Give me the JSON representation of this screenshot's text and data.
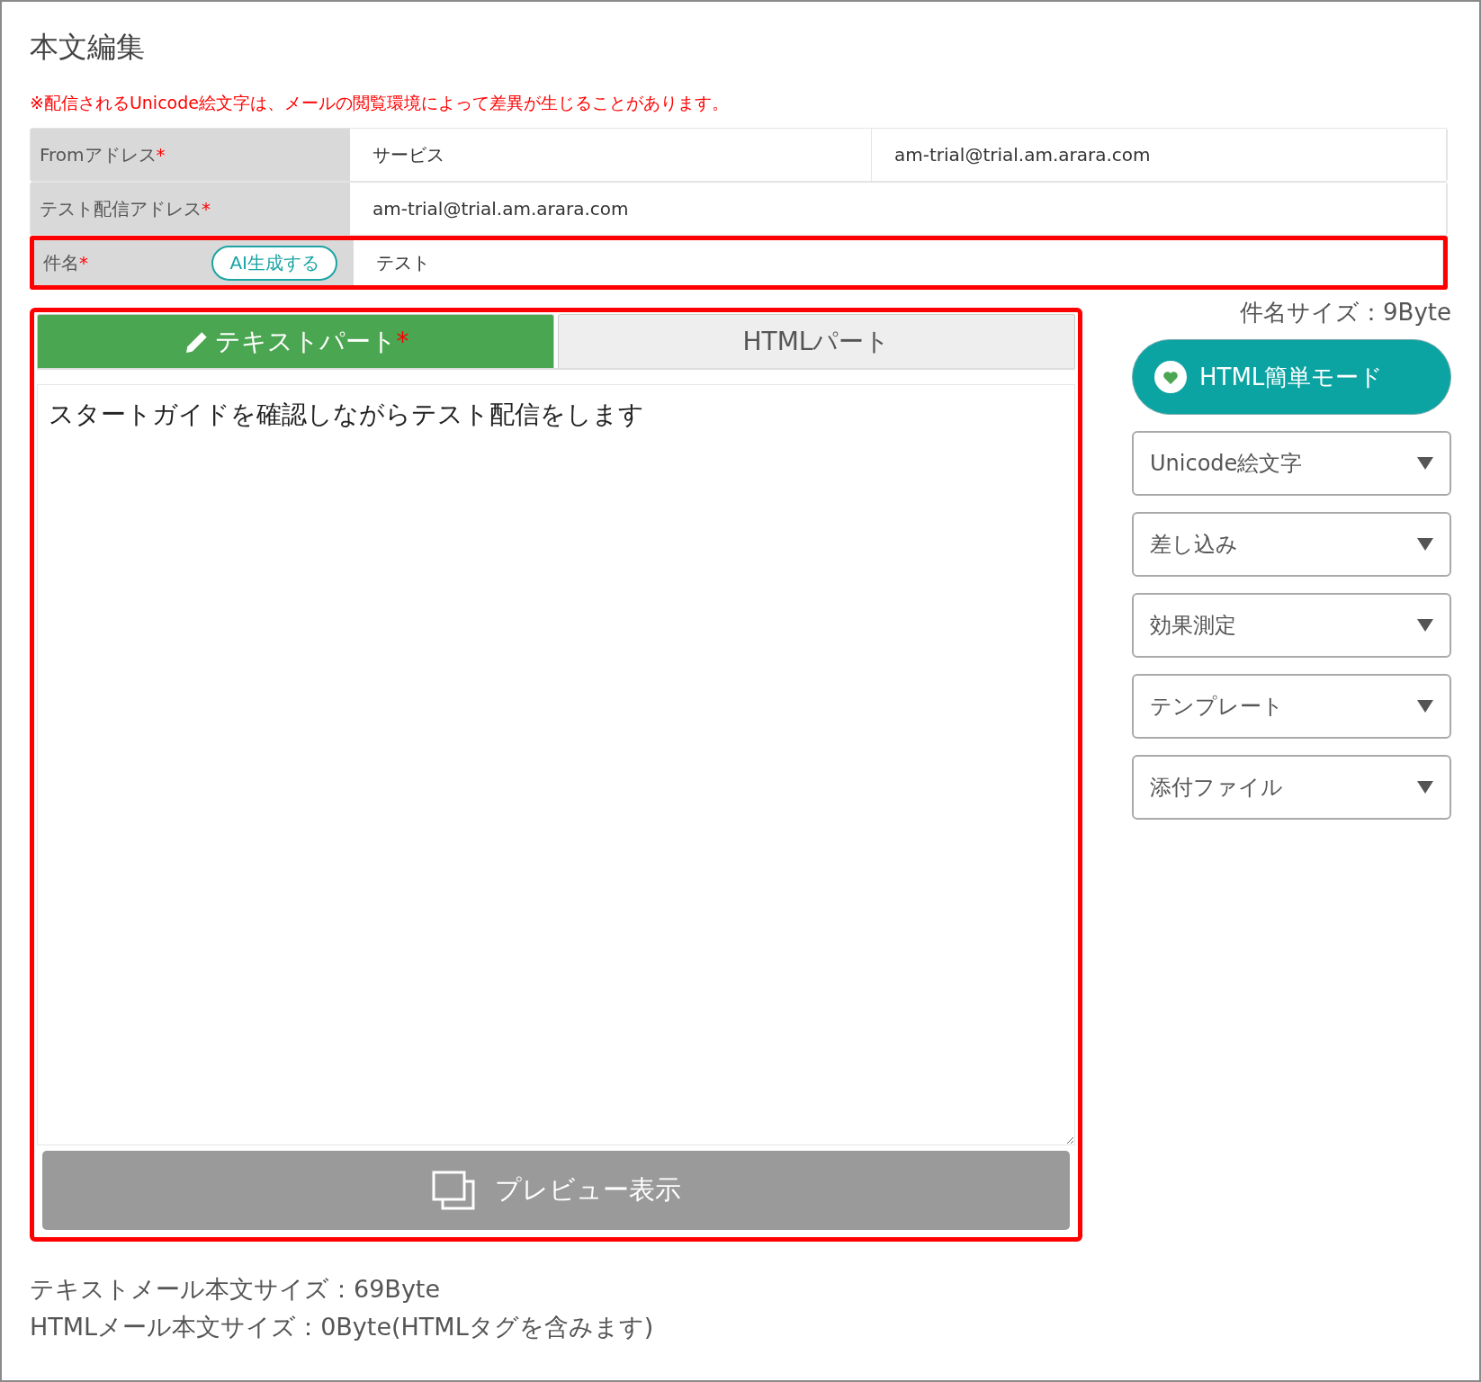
{
  "title": "本文編集",
  "notice": "※配信されるUnicode絵文字は、メールの閲覧環境によって差異が生じることがあります。",
  "fields": [
    {
      "label": "Fromアドレス",
      "mark": "*",
      "values": [
        "サービス",
        "am-trial@trial.am.arara.com"
      ],
      "highlighted": false
    },
    {
      "label": "テスト配信アドレス",
      "mark": "*",
      "values": [
        "am-trial@trial.am.arara.com"
      ],
      "highlighted": false
    },
    {
      "label": "件名",
      "mark": "*",
      "button": "AI生成する",
      "values": [
        "テスト"
      ],
      "highlighted": true
    }
  ],
  "editor": {
    "highlighted": true,
    "tabs": [
      {
        "label": "テキストパート",
        "mark": "*",
        "selected": true
      },
      {
        "label": "HTMLパート",
        "selected": false
      }
    ],
    "value": "スタートガイドを確認しながらテスト配信をします",
    "preview_button": "プレビュー表示"
  },
  "subject_size": "件名サイズ：9Byte",
  "mode_button": "HTML簡単モード",
  "dropdowns": [
    "Unicode絵文字",
    "差し込み",
    "効果測定",
    "テンプレート",
    "添付ファイル"
  ],
  "text_size": "テキストメール本文サイズ：69Byte",
  "html_size": "HTMLメール本文サイズ：0Byte(HTMLタグを含みます)"
}
